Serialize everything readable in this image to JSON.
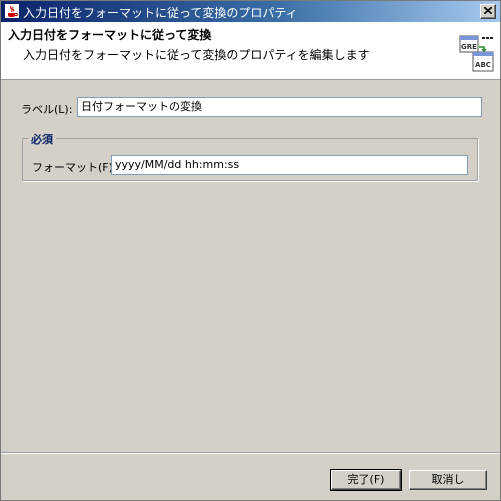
{
  "window": {
    "title": "入力日付をフォーマットに従って変換のプロパティ",
    "close_label": "×"
  },
  "header": {
    "title": "入力日付をフォーマットに従って変換",
    "description": "入力日付をフォーマットに従って変換のプロパティを編集します",
    "icon": "date-convert-icon",
    "icon_text_top": "GRE",
    "icon_text_bottom": "ABC"
  },
  "form": {
    "label_caption": "ラベル(L):",
    "label_value": "日付フォーマットの変換",
    "required_group": {
      "legend": "必須",
      "format_caption": "フォーマット(F):",
      "format_value": "yyyy/MM/dd hh:mm:ss"
    }
  },
  "buttons": {
    "finish_label": "完了(F)",
    "cancel_label": "取消し"
  },
  "colors": {
    "titlebar_start": "#0a246a",
    "titlebar_end": "#a6caf0",
    "dialog_bg": "#d4d0c8",
    "legend_color": "#0a246a"
  }
}
